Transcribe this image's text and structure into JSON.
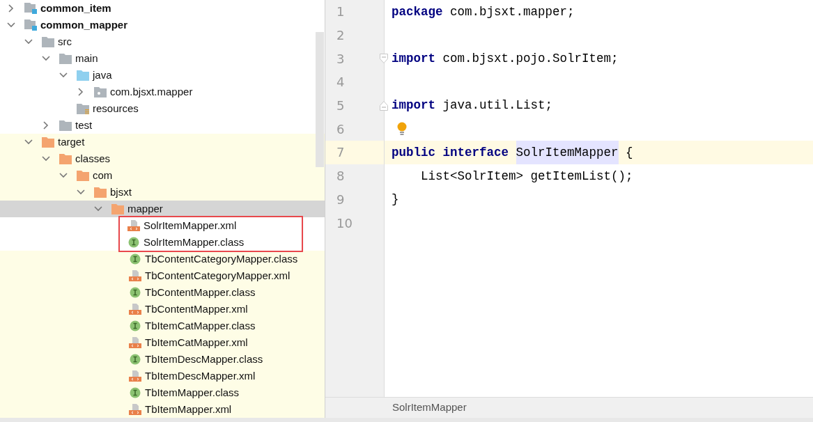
{
  "project_tree": [
    {
      "label": "common_item",
      "kind": "module",
      "expanded": false
    },
    {
      "label": "common_mapper",
      "kind": "module",
      "expanded": true,
      "children": [
        {
          "label": "src",
          "kind": "folder",
          "expanded": true,
          "children": [
            {
              "label": "main",
              "kind": "folder",
              "expanded": true,
              "children": [
                {
                  "label": "java",
                  "kind": "source",
                  "expanded": true,
                  "children": [
                    {
                      "label": "com.bjsxt.mapper",
                      "kind": "package",
                      "expanded": false
                    }
                  ]
                },
                {
                  "label": "resources",
                  "kind": "resources"
                }
              ]
            },
            {
              "label": "test",
              "kind": "folder",
              "expanded": false
            }
          ]
        },
        {
          "label": "target",
          "kind": "folder",
          "excluded": true,
          "expanded": true,
          "children": [
            {
              "label": "classes",
              "kind": "folder",
              "expanded": true,
              "children": [
                {
                  "label": "com",
                  "kind": "folder",
                  "expanded": true,
                  "children": [
                    {
                      "label": "bjsxt",
                      "kind": "folder",
                      "expanded": true,
                      "children": [
                        {
                          "label": "mapper",
                          "kind": "folder",
                          "expanded": true,
                          "selected": true,
                          "children": [
                            {
                              "label": "SolrItemMapper.xml",
                              "kind": "xml",
                              "highlighted": true
                            },
                            {
                              "label": "SolrItemMapper.class",
                              "kind": "class",
                              "highlighted": true
                            },
                            {
                              "label": "TbContentCategoryMapper.class",
                              "kind": "class"
                            },
                            {
                              "label": "TbContentCategoryMapper.xml",
                              "kind": "xml"
                            },
                            {
                              "label": "TbContentMapper.class",
                              "kind": "class"
                            },
                            {
                              "label": "TbContentMapper.xml",
                              "kind": "xml"
                            },
                            {
                              "label": "TbItemCatMapper.class",
                              "kind": "class"
                            },
                            {
                              "label": "TbItemCatMapper.xml",
                              "kind": "xml"
                            },
                            {
                              "label": "TbItemDescMapper.class",
                              "kind": "class"
                            },
                            {
                              "label": "TbItemDescMapper.xml",
                              "kind": "xml"
                            },
                            {
                              "label": "TbItemMapper.class",
                              "kind": "class"
                            },
                            {
                              "label": "TbItemMapper.xml",
                              "kind": "xml"
                            }
                          ]
                        }
                      ]
                    }
                  ]
                }
              ]
            }
          ]
        }
      ]
    }
  ],
  "editor": {
    "lines": [
      {
        "number": "1",
        "tokens": [
          {
            "text": "package",
            "kind": "keyword"
          },
          {
            "text": "com.bjsxt.mapper;",
            "kind": "plain"
          }
        ]
      },
      {
        "number": "2"
      },
      {
        "number": "3",
        "fold_start": true,
        "tokens": [
          {
            "text": "import",
            "kind": "keyword"
          },
          {
            "text": "com.bjsxt.pojo.SolrItem;",
            "kind": "plain"
          }
        ]
      },
      {
        "number": "4"
      },
      {
        "number": "5",
        "fold_end": true,
        "tokens": [
          {
            "text": "import",
            "kind": "keyword"
          },
          {
            "text": "java.util.List;",
            "kind": "plain"
          }
        ]
      },
      {
        "number": "6",
        "bulb": true
      },
      {
        "number": "7",
        "current": true,
        "tokens": [
          {
            "text": "public",
            "kind": "keyword"
          },
          {
            "text": "interface",
            "kind": "keyword"
          },
          {
            "text": "SolrItemMapper",
            "kind": "highlight"
          },
          {
            "text": "{",
            "kind": "plain"
          }
        ]
      },
      {
        "number": "8",
        "indented": true,
        "tokens": [
          {
            "text": "List<SolrItem>",
            "kind": "plain"
          },
          {
            "text": "getItemList();",
            "kind": "plain"
          }
        ]
      },
      {
        "number": "9",
        "tokens": [
          {
            "text": "}",
            "kind": "plain"
          }
        ]
      },
      {
        "number": "10"
      }
    ],
    "breadcrumb": "SolrItemMapper"
  }
}
